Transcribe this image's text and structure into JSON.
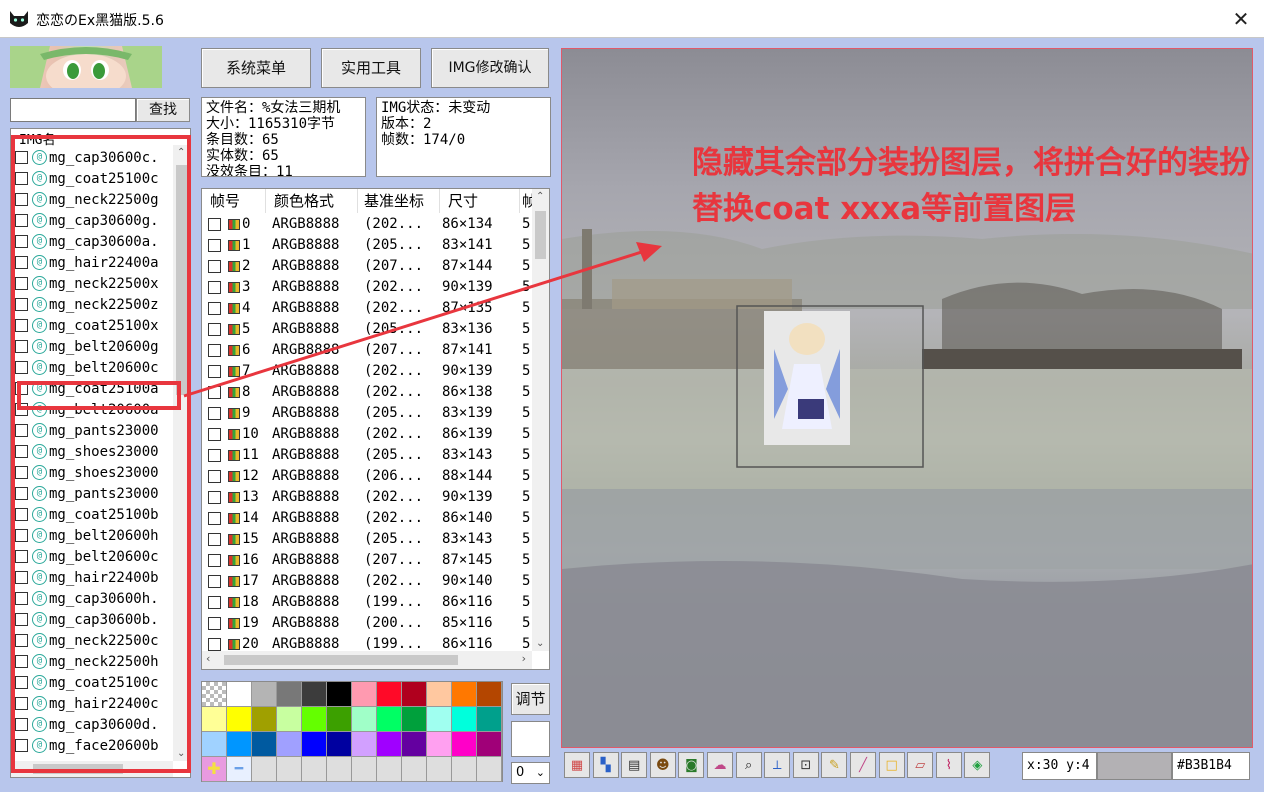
{
  "window": {
    "title": "恋恋のEx黑猫版.5.6",
    "app_icon": "black-cat-icon",
    "close_symbol": "✕"
  },
  "toolbar": {
    "system_menu": "系统菜单",
    "tools": "实用工具",
    "img_confirm": "IMG修改确认",
    "search_button": "查找",
    "search_value": "",
    "adjust_button": "调节",
    "layer_select_value": "0"
  },
  "img_list": {
    "header": "IMG名",
    "items": [
      "mg_cap30600c.",
      "mg_coat25100c",
      "mg_neck22500g",
      "mg_cap30600g.",
      "mg_cap30600a.",
      "mg_hair22400a",
      "mg_neck22500x",
      "mg_neck22500z",
      "mg_coat25100x",
      "mg_belt20600g",
      "mg_belt20600c",
      "mg_coat25100a",
      "mg_belt20600a",
      "mg_pants23000",
      "mg_shoes23000",
      "mg_shoes23000",
      "mg_pants23000",
      "mg_coat25100b",
      "mg_belt20600h",
      "mg_belt20600c",
      "mg_hair22400b",
      "mg_cap30600h.",
      "mg_cap30600b.",
      "mg_neck22500c",
      "mg_neck22500h",
      "mg_coat25100c",
      "mg_hair22400c",
      "mg_cap30600d.",
      "mg_face20600b"
    ]
  },
  "file_info": {
    "filename": "文件名：%女法三期机",
    "size": "大小：1165310字节",
    "entries": "条目数：65",
    "entities": "实体数：65",
    "extra": "没效条目：11"
  },
  "img_info": {
    "status": "IMG状态：未变动",
    "version": "版本：2",
    "frames": "帧数：174/0"
  },
  "frame_table": {
    "headers": [
      "帧号",
      "颜色格式",
      "基准坐标",
      "尺寸",
      "帧"
    ],
    "rows": [
      [
        "0",
        "ARGB8888",
        "(202...",
        "86×134",
        "5"
      ],
      [
        "1",
        "ARGB8888",
        "(205...",
        "83×141",
        "5"
      ],
      [
        "2",
        "ARGB8888",
        "(207...",
        "87×144",
        "5"
      ],
      [
        "3",
        "ARGB8888",
        "(202...",
        "90×139",
        "5"
      ],
      [
        "4",
        "ARGB8888",
        "(202...",
        "87×135",
        "5"
      ],
      [
        "5",
        "ARGB8888",
        "(205...",
        "83×136",
        "5"
      ],
      [
        "6",
        "ARGB8888",
        "(207...",
        "87×141",
        "5"
      ],
      [
        "7",
        "ARGB8888",
        "(202...",
        "90×139",
        "5"
      ],
      [
        "8",
        "ARGB8888",
        "(202...",
        "86×138",
        "5"
      ],
      [
        "9",
        "ARGB8888",
        "(205...",
        "83×139",
        "5"
      ],
      [
        "10",
        "ARGB8888",
        "(202...",
        "86×139",
        "5"
      ],
      [
        "11",
        "ARGB8888",
        "(205...",
        "83×143",
        "5"
      ],
      [
        "12",
        "ARGB8888",
        "(206...",
        "88×144",
        "5"
      ],
      [
        "13",
        "ARGB8888",
        "(202...",
        "90×139",
        "5"
      ],
      [
        "14",
        "ARGB8888",
        "(202...",
        "86×140",
        "5"
      ],
      [
        "15",
        "ARGB8888",
        "(205...",
        "83×143",
        "5"
      ],
      [
        "16",
        "ARGB8888",
        "(207...",
        "87×145",
        "5"
      ],
      [
        "17",
        "ARGB8888",
        "(202...",
        "90×140",
        "5"
      ],
      [
        "18",
        "ARGB8888",
        "(199...",
        "86×116",
        "5"
      ],
      [
        "19",
        "ARGB8888",
        "(200...",
        "85×116",
        "5"
      ],
      [
        "20",
        "ARGB8888",
        "(199...",
        "86×116",
        "5"
      ]
    ]
  },
  "palette": {
    "colors": [
      "#cccccc",
      "#ffffff",
      "#b4b4b4",
      "#787878",
      "#3c3c3c",
      "#000000",
      "#ff9ab0",
      "#ff0a28",
      "#b0001e",
      "#ffc8a0",
      "#ff7800",
      "#b44600",
      "#ffff96",
      "#ffff00",
      "#a0a000",
      "#c8ffa0",
      "#64ff00",
      "#3ca000",
      "#a0ffc8",
      "#00ff64",
      "#00a03c",
      "#a0fff0",
      "#00ffdc",
      "#00a08c",
      "#a0d2ff",
      "#0096ff",
      "#005aa0",
      "#a0a0ff",
      "#0000ff",
      "#0000a0",
      "#d2a0ff",
      "#a000ff",
      "#6400a0",
      "#ffa0f0",
      "#ff00c8",
      "#a00078"
    ],
    "add_symbol": "✚",
    "remove_symbol": "━"
  },
  "canvas": {
    "annotation": "隐藏其余部分装扮图层，将拼合好的装扮替换coat xxxa等前置图层"
  },
  "tools": [
    "layers-icon",
    "palette-grid-icon",
    "film-icon",
    "sprite-icon",
    "camera-icon",
    "cloud-icon",
    "zoom-icon",
    "axis-icon",
    "crop-icon",
    "pencil-icon",
    "line-icon",
    "rectangle-icon",
    "eraser-icon",
    "eyedropper-icon",
    "fill-icon"
  ],
  "status": {
    "coords": "x:30 y:4",
    "color_hex": "#B3B1B4"
  }
}
